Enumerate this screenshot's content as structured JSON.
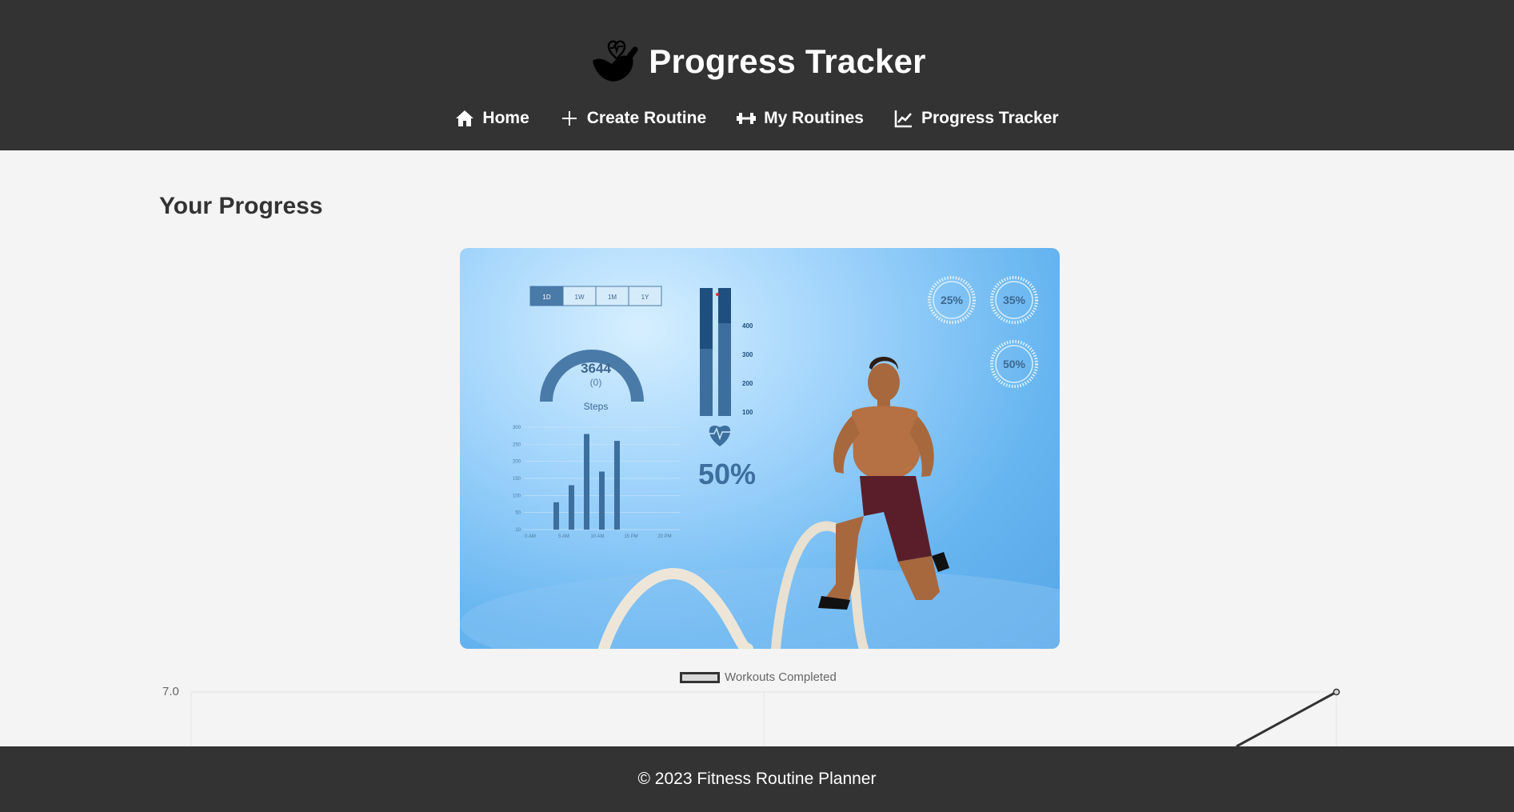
{
  "header": {
    "title": "Progress Tracker",
    "logo_icon": "flexed-arm-heart-icon"
  },
  "nav": {
    "items": [
      {
        "label": "Home",
        "icon": "home-icon"
      },
      {
        "label": "Create Routine",
        "icon": "plus-icon"
      },
      {
        "label": "My Routines",
        "icon": "dumbbell-icon"
      },
      {
        "label": "Progress Tracker",
        "icon": "line-chart-icon"
      }
    ]
  },
  "main": {
    "title": "Your Progress",
    "hero": {
      "tabs": [
        "1D",
        "1W",
        "1M",
        "1Y"
      ],
      "steps_value": "3644",
      "steps_sub": "(0)",
      "steps_label": "Steps",
      "bar_scale": [
        "400",
        "300",
        "200",
        "100"
      ],
      "heart_percent": "50%",
      "rings": [
        "25%",
        "35%",
        "50%"
      ],
      "mini_y": [
        "300",
        "250",
        "200",
        "150",
        "100",
        "50",
        "10"
      ],
      "mini_x": [
        "0 AM",
        "5 AM",
        "10 AM",
        "15 PM",
        "20 PM"
      ],
      "mini_values": [
        40,
        65,
        140,
        85,
        130
      ],
      "mini_ymax": 150
    }
  },
  "chart_data": {
    "type": "line",
    "series": [
      {
        "name": "Workouts Completed",
        "values": [
          7.0
        ]
      }
    ],
    "visible_ytick": "7.0",
    "grid": true,
    "legend_position": "top-center",
    "colors": {
      "line": "#333333",
      "legend_fill": "#d9d9d9"
    }
  },
  "footer": {
    "text": "© 2023 Fitness Routine Planner"
  }
}
